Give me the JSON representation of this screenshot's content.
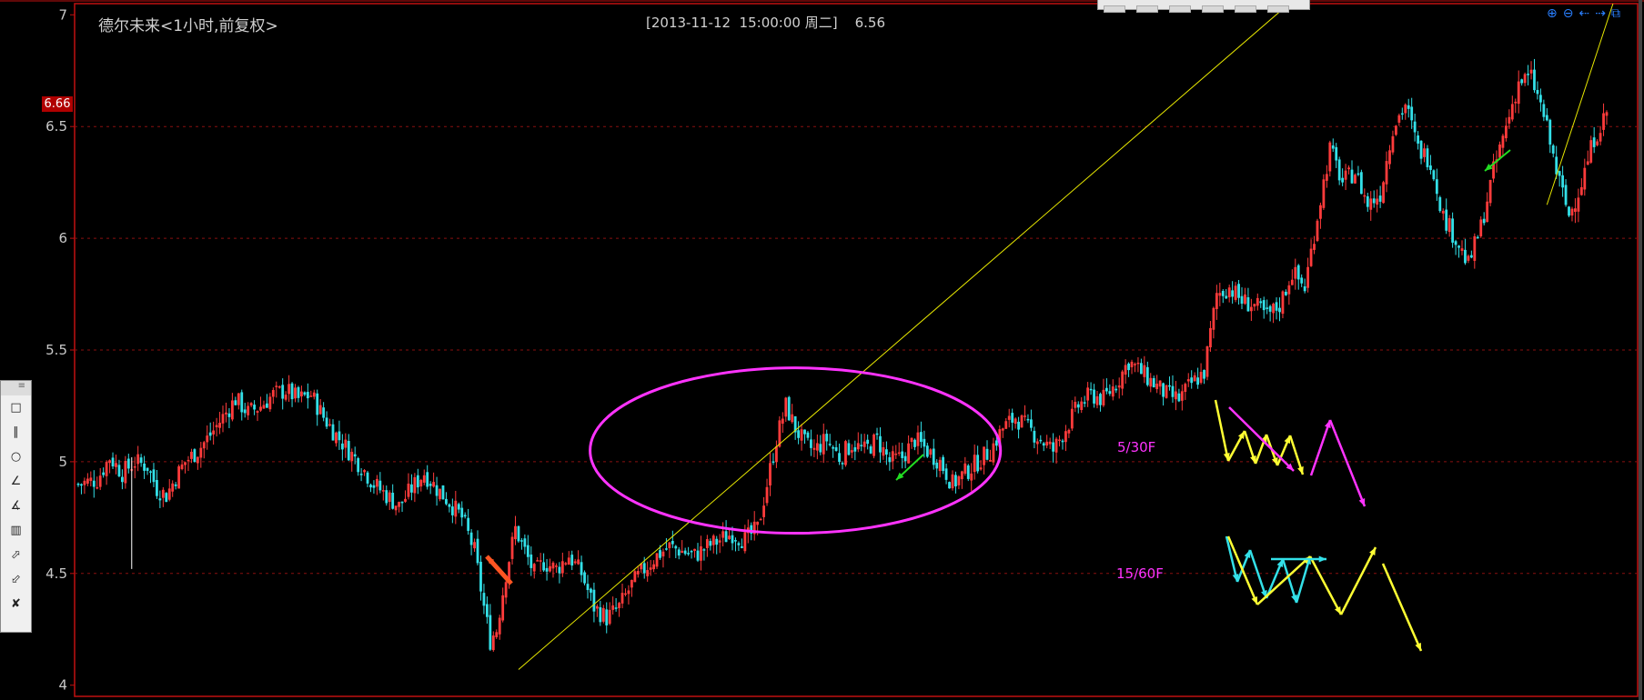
{
  "header": {
    "title": "德尔未来<1小时,前复权>",
    "info": "[2013-11-12  15:00:00 周二]    6.56",
    "price_tag": "6.66"
  },
  "colors": {
    "up": "#ff3b3b",
    "down": "#33e0e8",
    "grid": "#8a1010",
    "frame": "#c01010",
    "trendline": "#e8e800",
    "ellipse": "#ff33ff",
    "label": "#ff33ff",
    "zig_yellow": "#ffff33",
    "zig_magenta": "#ff33ff",
    "zig_cyan": "#33e0e8"
  },
  "annotations": {
    "label_1": "5/30F",
    "label_2": "15/60F"
  },
  "toolbar": {
    "zoom_in": "zoom-in-icon",
    "zoom_out": "zoom-out-icon",
    "pan_left": "arrow-left-icon",
    "pan_right": "arrow-right-icon",
    "window": "window-icon"
  },
  "side_tools": [
    {
      "icon": "rectangle-icon",
      "glyph": "□"
    },
    {
      "icon": "parallel-lines-icon",
      "glyph": "∥"
    },
    {
      "icon": "ellipse-icon",
      "glyph": "○"
    },
    {
      "icon": "angle-icon",
      "glyph": "∠"
    },
    {
      "icon": "fibonacci-icon",
      "glyph": "∡"
    },
    {
      "icon": "histogram-icon",
      "glyph": "▥"
    },
    {
      "icon": "red-arrow-icon",
      "glyph": "⬀"
    },
    {
      "icon": "green-arrow-icon",
      "glyph": "⬃"
    },
    {
      "icon": "delete-icon",
      "glyph": "✘"
    }
  ],
  "chart_data": {
    "type": "candlestick",
    "title": "德尔未来<1小时,前复权>",
    "ylim": [
      3.95,
      7.05
    ],
    "yticks": [
      "7",
      "6.5",
      "6",
      "5.5",
      "5",
      "4.5",
      "4"
    ],
    "ytick_values": [
      7,
      6.5,
      6,
      5.5,
      5,
      4.5,
      4
    ],
    "grid": true,
    "last_price": 6.66,
    "close_path": [
      [
        0,
        4.9
      ],
      [
        6,
        4.92
      ],
      [
        10,
        5.02
      ],
      [
        14,
        4.95
      ],
      [
        18,
        5.0
      ],
      [
        22,
        4.98
      ],
      [
        25,
        4.88
      ],
      [
        28,
        4.85
      ],
      [
        31,
        4.93
      ],
      [
        34,
        5.0
      ],
      [
        38,
        5.05
      ],
      [
        42,
        5.12
      ],
      [
        46,
        5.2
      ],
      [
        50,
        5.28
      ],
      [
        54,
        5.22
      ],
      [
        58,
        5.25
      ],
      [
        62,
        5.3
      ],
      [
        66,
        5.32
      ],
      [
        70,
        5.28
      ],
      [
        74,
        5.3
      ],
      [
        78,
        5.2
      ],
      [
        82,
        5.12
      ],
      [
        86,
        5.05
      ],
      [
        90,
        4.98
      ],
      [
        94,
        4.9
      ],
      [
        98,
        4.85
      ],
      [
        102,
        4.8
      ],
      [
        106,
        4.88
      ],
      [
        110,
        4.95
      ],
      [
        114,
        4.88
      ],
      [
        118,
        4.82
      ],
      [
        122,
        4.75
      ],
      [
        126,
        4.6
      ],
      [
        129,
        4.35
      ],
      [
        131,
        4.2
      ],
      [
        133,
        4.25
      ],
      [
        136,
        4.5
      ],
      [
        139,
        4.7
      ],
      [
        142,
        4.6
      ],
      [
        145,
        4.5
      ],
      [
        148,
        4.55
      ],
      [
        152,
        4.52
      ],
      [
        156,
        4.58
      ],
      [
        160,
        4.5
      ],
      [
        164,
        4.35
      ],
      [
        168,
        4.3
      ],
      [
        172,
        4.35
      ],
      [
        176,
        4.45
      ],
      [
        180,
        4.52
      ],
      [
        184,
        4.58
      ],
      [
        188,
        4.62
      ],
      [
        192,
        4.6
      ],
      [
        196,
        4.58
      ],
      [
        200,
        4.62
      ],
      [
        204,
        4.65
      ],
      [
        208,
        4.68
      ],
      [
        212,
        4.65
      ],
      [
        216,
        4.7
      ],
      [
        219,
        4.9
      ],
      [
        222,
        5.1
      ],
      [
        225,
        5.25
      ],
      [
        228,
        5.15
      ],
      [
        231,
        5.08
      ],
      [
        234,
        5.05
      ],
      [
        238,
        5.1
      ],
      [
        242,
        5.02
      ],
      [
        246,
        5.08
      ],
      [
        250,
        5.05
      ],
      [
        254,
        5.1
      ],
      [
        258,
        5.0
      ],
      [
        262,
        5.02
      ],
      [
        266,
        5.1
      ],
      [
        270,
        5.05
      ],
      [
        274,
        5.0
      ],
      [
        278,
        4.9
      ],
      [
        282,
        4.95
      ],
      [
        286,
        5.0
      ],
      [
        290,
        5.05
      ],
      [
        294,
        5.15
      ],
      [
        298,
        5.2
      ],
      [
        302,
        5.15
      ],
      [
        306,
        5.1
      ],
      [
        310,
        5.05
      ],
      [
        314,
        5.15
      ],
      [
        318,
        5.25
      ],
      [
        322,
        5.3
      ],
      [
        326,
        5.28
      ],
      [
        330,
        5.35
      ],
      [
        334,
        5.45
      ],
      [
        338,
        5.4
      ],
      [
        342,
        5.35
      ],
      [
        346,
        5.3
      ],
      [
        350,
        5.28
      ],
      [
        354,
        5.35
      ],
      [
        358,
        5.4
      ],
      [
        362,
        5.75
      ],
      [
        366,
        5.78
      ],
      [
        370,
        5.72
      ],
      [
        374,
        5.7
      ],
      [
        378,
        5.65
      ],
      [
        382,
        5.7
      ],
      [
        386,
        5.85
      ],
      [
        390,
        5.78
      ],
      [
        394,
        6.1
      ],
      [
        398,
        6.4
      ],
      [
        402,
        6.25
      ],
      [
        406,
        6.3
      ],
      [
        410,
        6.15
      ],
      [
        414,
        6.2
      ],
      [
        418,
        6.5
      ],
      [
        422,
        6.6
      ],
      [
        426,
        6.4
      ],
      [
        430,
        6.35
      ],
      [
        434,
        6.1
      ],
      [
        438,
        6.0
      ],
      [
        442,
        5.88
      ],
      [
        446,
        6.05
      ],
      [
        450,
        6.3
      ],
      [
        454,
        6.5
      ],
      [
        458,
        6.7
      ],
      [
        462,
        6.72
      ],
      [
        466,
        6.55
      ],
      [
        470,
        6.3
      ],
      [
        474,
        6.1
      ],
      [
        478,
        6.25
      ],
      [
        482,
        6.45
      ],
      [
        486,
        6.56
      ]
    ],
    "trendline": {
      "from": [
        140,
        4.07
      ],
      "to": [
        385,
        7.05
      ]
    },
    "trendline_2": {
      "from": [
        467,
        6.15
      ],
      "to": [
        488,
        7.05
      ]
    },
    "ellipse": {
      "cx": 228,
      "cy": 5.05,
      "rx_bars": 45,
      "ry_price": 0.37
    }
  }
}
